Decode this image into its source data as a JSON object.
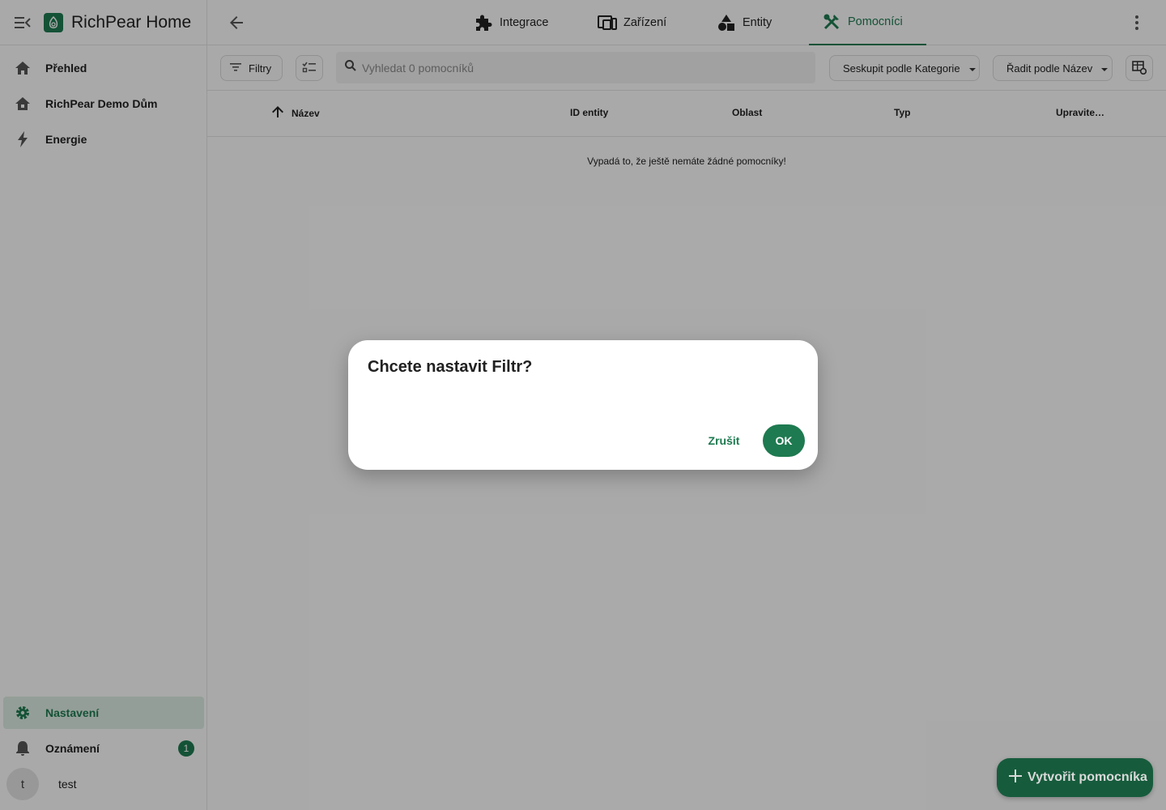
{
  "app": {
    "title": "RichPear Home"
  },
  "sidebar": {
    "items": [
      {
        "label": "Přehled",
        "icon": "home-icon"
      },
      {
        "label": "RichPear Demo Dům",
        "icon": "home-roof-icon"
      },
      {
        "label": "Energie",
        "icon": "lightning-bolt-icon"
      }
    ],
    "bottom": {
      "settings_label": "Nastavení",
      "notifications_label": "Oznámení",
      "notifications_count": "1",
      "user_name": "test",
      "user_initial": "t"
    }
  },
  "tabs": [
    {
      "label": "Integrace",
      "icon": "puzzle-icon",
      "active": false
    },
    {
      "label": "Zařízení",
      "icon": "devices-icon",
      "active": false
    },
    {
      "label": "Entity",
      "icon": "shapes-icon",
      "active": false
    },
    {
      "label": "Pomocníci",
      "icon": "tools-icon",
      "active": true
    }
  ],
  "toolbar": {
    "filters_label": "Filtry",
    "search_placeholder": "Vyhledat 0 pomocníků",
    "group_by_label": "Seskupit podle Kategorie",
    "sort_by_label": "Řadit podle Název"
  },
  "table": {
    "columns": [
      "Název",
      "ID entity",
      "Oblast",
      "Typ",
      "Upravite…"
    ],
    "empty_message": "Vypadá to, že ještě nemáte žádné pomocníky!"
  },
  "fab": {
    "label": "Vytvořit pomocníka"
  },
  "dialog": {
    "title": "Chcete nastavit Filtr?",
    "cancel_label": "Zrušit",
    "ok_label": "OK"
  },
  "colors": {
    "accent": "#1e7a50",
    "active_bg": "#dbe9e0",
    "scrim": "rgba(0,0,0,0.32)"
  }
}
